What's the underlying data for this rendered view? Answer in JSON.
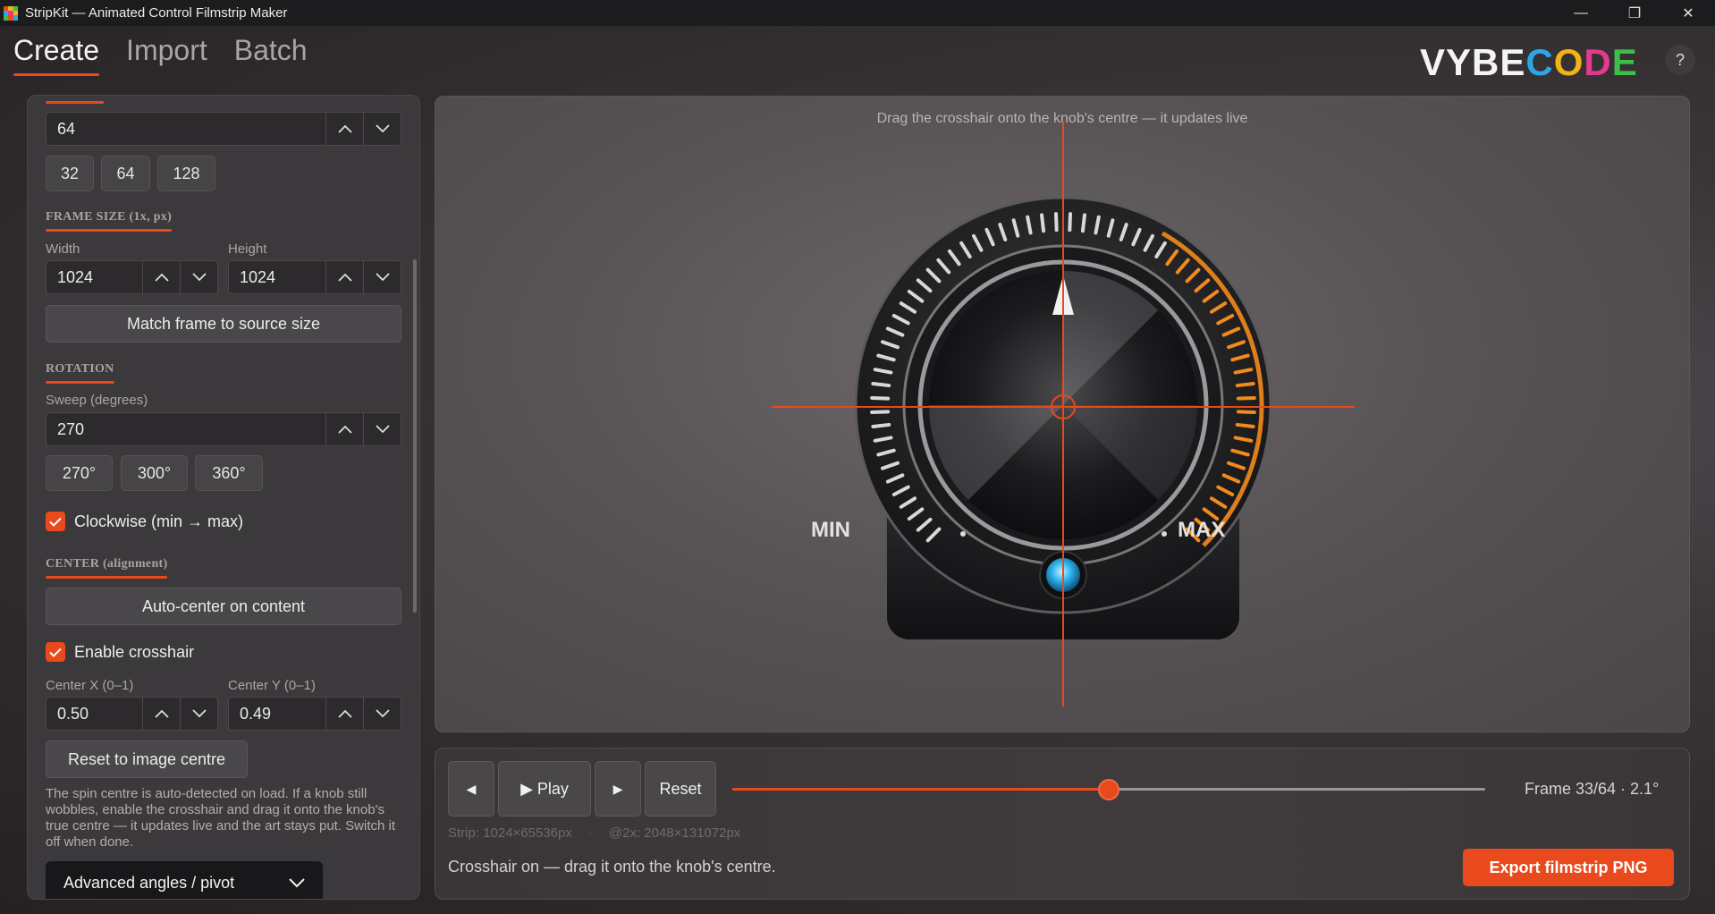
{
  "window": {
    "title": "StripKit — Animated Control Filmstrip Maker",
    "minimize": "—",
    "maximize": "❐",
    "close": "✕"
  },
  "nav": {
    "tabs": [
      {
        "label": "Create",
        "active": true
      },
      {
        "label": "Import",
        "active": false
      },
      {
        "label": "Batch",
        "active": false
      }
    ]
  },
  "brand": {
    "letters": [
      {
        "ch": "V",
        "color": "#f4f4f4"
      },
      {
        "ch": "Y",
        "color": "#f4f4f4"
      },
      {
        "ch": "B",
        "color": "#f4f4f4"
      },
      {
        "ch": "E",
        "color": "#f4f4f4"
      },
      {
        "ch": "C",
        "color": "#2aa7e8"
      },
      {
        "ch": "O",
        "color": "#f2b316"
      },
      {
        "ch": "D",
        "color": "#e23a8c"
      },
      {
        "ch": "E",
        "color": "#3cbf4a"
      }
    ],
    "help": "?"
  },
  "frames": {
    "value": "64",
    "presets": [
      "32",
      "64",
      "128"
    ]
  },
  "frame_size": {
    "heading": "FRAME SIZE (1x, px)",
    "width_label": "Width",
    "width_value": "1024",
    "height_label": "Height",
    "height_value": "1024",
    "match_button": "Match frame to source size"
  },
  "rotation": {
    "heading": "ROTATION",
    "sweep_label": "Sweep (degrees)",
    "sweep_value": "270",
    "presets": [
      "270°",
      "300°",
      "360°"
    ],
    "clockwise_label": "Clockwise (min → max)",
    "clockwise_checked": true
  },
  "center": {
    "heading": "CENTER (alignment)",
    "auto_button": "Auto-center on content",
    "crosshair_label": "Enable crosshair",
    "crosshair_checked": true,
    "x_label": "Center X (0–1)",
    "x_value": "0.50",
    "y_label": "Center Y (0–1)",
    "y_value": "0.49",
    "reset_button": "Reset to image centre",
    "help": "The spin centre is auto-detected on load. If a knob still wobbles, enable the crosshair and drag it onto the knob's true centre — it updates live and the art stays put. Switch it off when done."
  },
  "advanced": {
    "label": "Advanced angles / pivot"
  },
  "canvas": {
    "hint": "Drag the crosshair onto the knob's centre — it updates live",
    "min_label": "MIN",
    "max_label": "MAX",
    "accent": "#e8491d",
    "led_color": "#2fb6f0",
    "arc_color": "#f28a1c"
  },
  "transport": {
    "prev": "◀",
    "play": "▶ Play",
    "next": "▶",
    "reset": "Reset",
    "progress": 0.5,
    "frame_readout": "Frame 33/64 · 2.1°",
    "strip": "Strip: 1024×65536px",
    "strip_2x": "@2x: 2048×131072px",
    "status": "Crosshair on — drag it onto the knob's centre.",
    "export": "Export filmstrip PNG"
  }
}
